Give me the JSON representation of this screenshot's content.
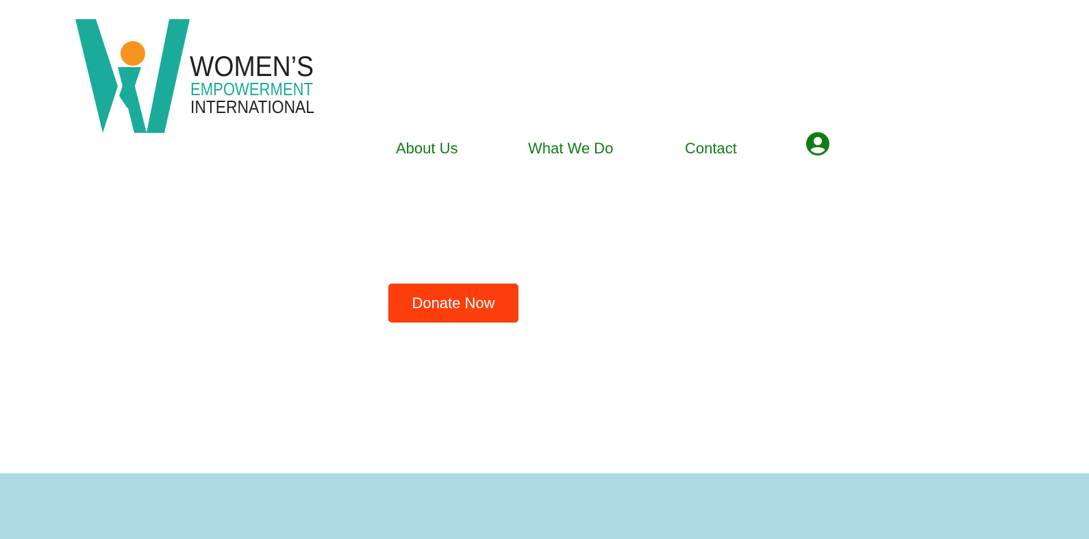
{
  "logo": {
    "line1": "WOMEN’S",
    "line2": "EMPOWERMENT",
    "line3": "INTERNATIONAL",
    "colors": {
      "teal": "#1aab9b",
      "orange": "#f7941d",
      "dark": "#231f20"
    }
  },
  "nav": {
    "items": [
      {
        "label": "About Us"
      },
      {
        "label": "What We Do"
      },
      {
        "label": "Contact"
      }
    ],
    "account_icon": "user-circle-icon",
    "link_color": "#0f7d12"
  },
  "hero": {
    "donate_label": "Donate Now",
    "donate_color": "#fc3e0c"
  },
  "footer_band": {
    "color": "#add8e4"
  }
}
